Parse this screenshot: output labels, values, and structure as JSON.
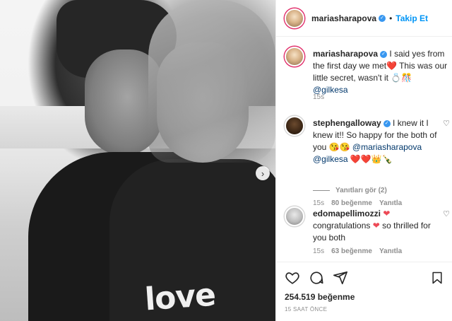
{
  "post": {
    "shirt_text": "love"
  },
  "header": {
    "username": "mariasharapova",
    "separator": "•",
    "follow_label": "Takip Et"
  },
  "caption": {
    "username": "mariasharapova",
    "text": "I said yes from the first day we met❤️ This was our little secret, wasn't it 💍🎊",
    "mention": "@gilkesa",
    "time": "15s"
  },
  "comments": [
    {
      "username": "stephengalloway",
      "text": "I knew it I knew it!! So happy for the both of you 😘😘",
      "mention1": "@mariasharapova",
      "mention2": "@gilkesa",
      "emoji_tail": "❤️❤️👑🍾",
      "time": "15s",
      "likes": "80 beğenme",
      "reply": "Yanıtla"
    },
    {
      "username": "edomapellimozzi",
      "text_pre": "congratulations",
      "text_post": "so thrilled for you both",
      "time": "15s",
      "likes": "63 beğenme",
      "reply": "Yanıtla"
    }
  ],
  "view_replies": "Yanıtları gör (2)",
  "likes_total": "254.519 beğenme",
  "post_time": "15 SAAT ÖNCE",
  "colors": {
    "accent": "#0095f6",
    "heart": "#ed4956",
    "muted": "#8e8e8e",
    "verified": "#3897f0"
  },
  "icons": [
    "heart-icon",
    "comment-icon",
    "share-icon",
    "bookmark-icon",
    "verified-icon",
    "chevron-right-icon"
  ]
}
